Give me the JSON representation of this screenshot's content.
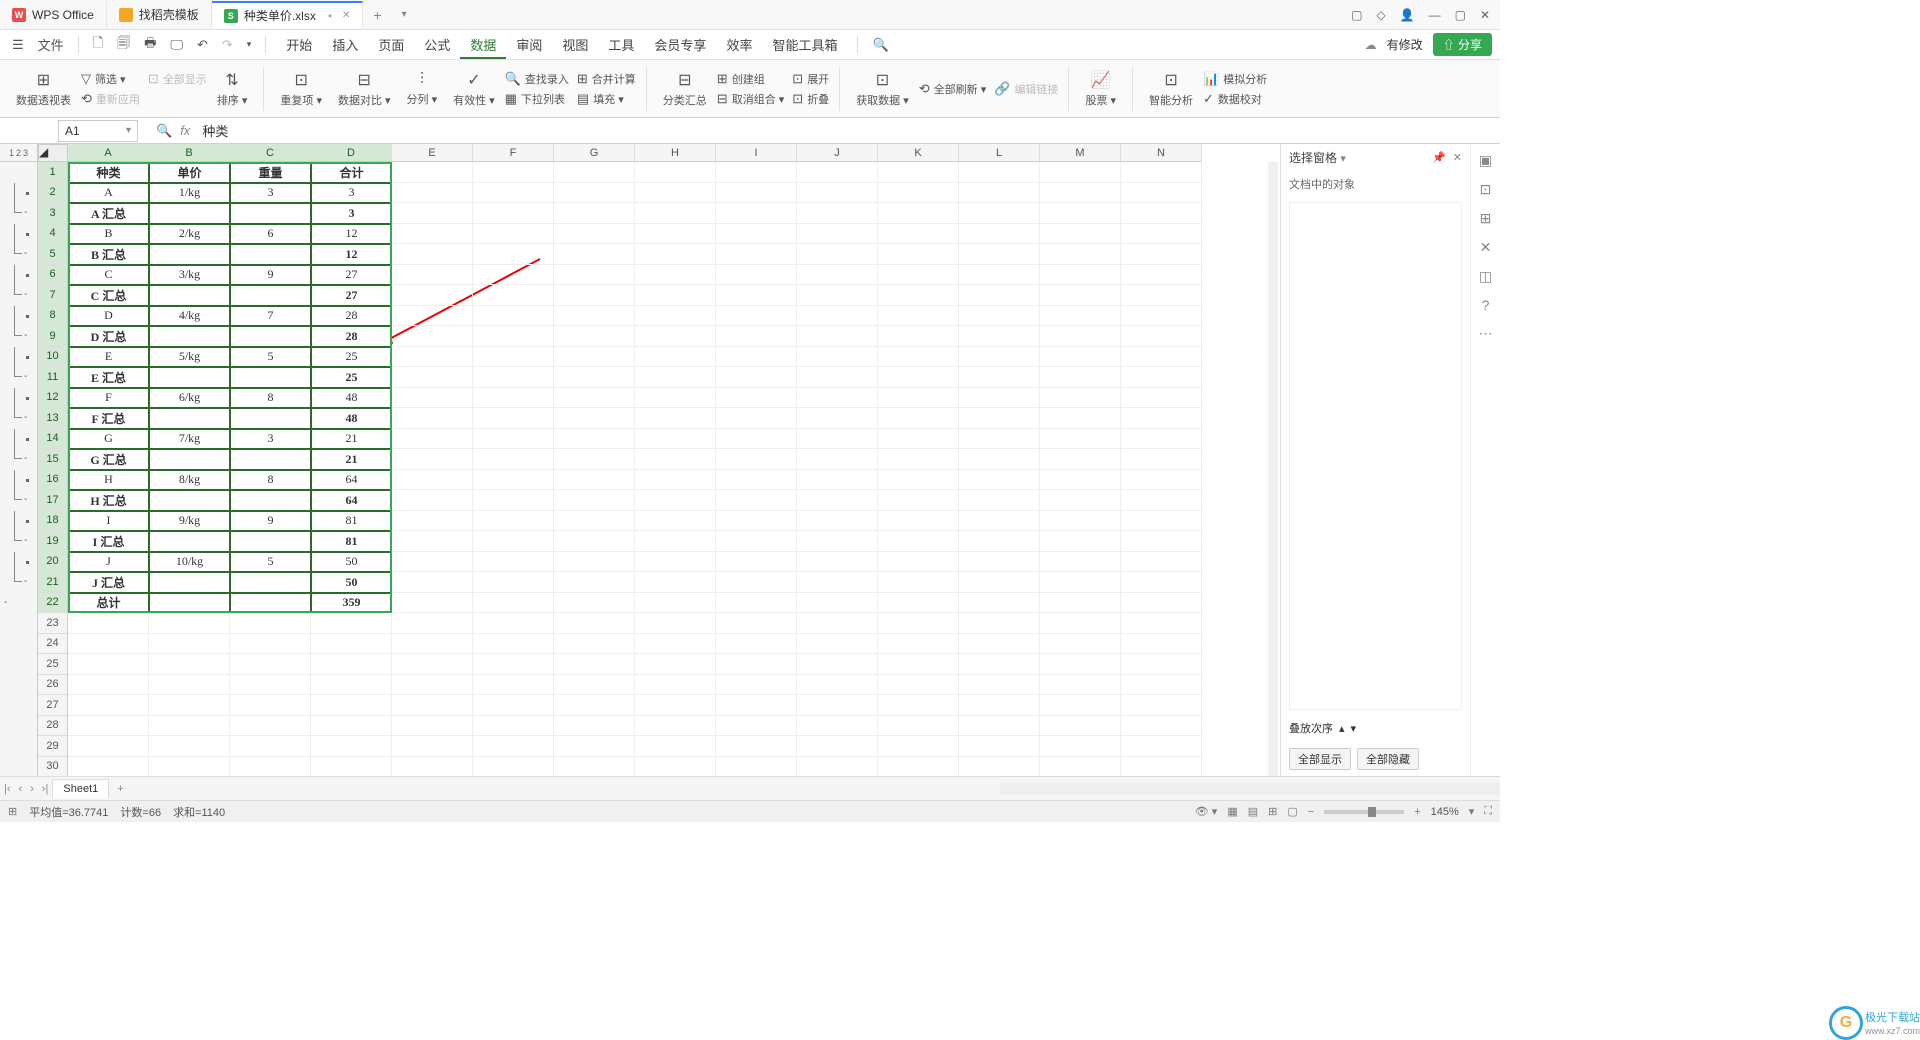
{
  "titlebar": {
    "tabs": [
      {
        "icon": "wps",
        "label": "WPS Office"
      },
      {
        "icon": "t",
        "label": "找稻壳模板"
      },
      {
        "icon": "s",
        "label": "种类单价.xlsx",
        "active": true,
        "dirty": true
      }
    ],
    "win_icons": [
      "▢",
      "◇",
      "👤",
      "—",
      "▢",
      "✕"
    ]
  },
  "menu": {
    "file": "文件",
    "quick_icons": [
      "🗋",
      "🗐",
      "🖶",
      "🖫",
      "↶",
      "↷",
      "▾"
    ],
    "tabs": [
      "开始",
      "插入",
      "页面",
      "公式",
      "数据",
      "审阅",
      "视图",
      "工具",
      "会员专享",
      "效率",
      "智能工具箱"
    ],
    "active_tab": "数据",
    "search_icon": "🔍",
    "right": {
      "cloud": "⟳",
      "modify": "有修改",
      "share": "分享"
    }
  },
  "ribbon": {
    "groups": [
      {
        "type": "big",
        "icon": "⊞",
        "label": "数据透视表"
      },
      {
        "type": "stack",
        "items": [
          {
            "icon": "▽",
            "label": "筛选",
            "dd": true
          },
          {
            "icon": "⟲",
            "label": "重新应用",
            "disabled": true
          }
        ],
        "side": [
          {
            "icon": "⊡",
            "label": "全部显示",
            "disabled": true
          }
        ]
      },
      {
        "type": "big",
        "icon": "⇅",
        "label": "排序",
        "dd": true
      },
      {
        "type": "sep"
      },
      {
        "type": "big",
        "icon": "⊡",
        "label": "重复项",
        "dd": true
      },
      {
        "type": "big",
        "icon": "⊟",
        "label": "数据对比",
        "dd": true
      },
      {
        "type": "big",
        "icon": "⫶",
        "label": "分列",
        "dd": true
      },
      {
        "type": "big",
        "icon": "✓",
        "label": "有效性",
        "dd": true
      },
      {
        "type": "stack2",
        "items": [
          {
            "icon": "🔍",
            "label": "查找录入"
          },
          {
            "icon": "▦",
            "label": "下拉列表"
          }
        ],
        "side": [
          {
            "icon": "⊞",
            "label": "合并计算"
          },
          {
            "icon": "▤",
            "label": "填充",
            "dd": true
          }
        ]
      },
      {
        "type": "sep"
      },
      {
        "type": "big",
        "icon": "⊟",
        "label": "分类汇总"
      },
      {
        "type": "stack2",
        "items": [
          {
            "icon": "⊞",
            "label": "创建组"
          },
          {
            "icon": "⊟",
            "label": "取消组合",
            "dd": true
          }
        ],
        "side": [
          {
            "icon": "⊡",
            "label": "展开"
          },
          {
            "icon": "⊡",
            "label": "折叠"
          }
        ]
      },
      {
        "type": "sep"
      },
      {
        "type": "big",
        "icon": "⊡",
        "label": "获取数据",
        "dd": true
      },
      {
        "type": "stack2",
        "items": [
          {
            "icon": "⟲",
            "label": "全部刷新",
            "dd": true
          }
        ],
        "side": [
          {
            "icon": "🔗",
            "label": "编辑链接",
            "disabled": true
          }
        ]
      },
      {
        "type": "sep"
      },
      {
        "type": "big",
        "icon": "📈",
        "label": "股票",
        "dd": true
      },
      {
        "type": "sep"
      },
      {
        "type": "big",
        "icon": "⊡",
        "label": "智能分析"
      },
      {
        "type": "stack2",
        "items": [
          {
            "icon": "📊",
            "label": "模拟分析"
          },
          {
            "icon": "✓",
            "label": "数据校对"
          }
        ]
      }
    ]
  },
  "formulabar": {
    "namebox": "A1",
    "fx": "fx",
    "value": "种类"
  },
  "outline_levels": [
    "1",
    "2",
    "3"
  ],
  "columns": [
    "A",
    "B",
    "C",
    "D",
    "E",
    "F",
    "G",
    "H",
    "I",
    "J",
    "K",
    "L",
    "M",
    "N"
  ],
  "sel_cols": [
    "A",
    "B",
    "C",
    "D"
  ],
  "rows": [
    {
      "n": 1,
      "sel": true,
      "type": "hdr",
      "cells": [
        "种类",
        "单价",
        "重量",
        "合计"
      ]
    },
    {
      "n": 2,
      "sel": true,
      "cells": [
        "A",
        "1/kg",
        "3",
        "3"
      ],
      "outline": "dot"
    },
    {
      "n": 3,
      "sel": true,
      "cells": [
        "A 汇总",
        "",
        "",
        "3"
      ],
      "bold": true,
      "outline": "end"
    },
    {
      "n": 4,
      "sel": true,
      "cells": [
        "B",
        "2/kg",
        "6",
        "12"
      ],
      "outline": "dot"
    },
    {
      "n": 5,
      "sel": true,
      "cells": [
        "B 汇总",
        "",
        "",
        "12"
      ],
      "bold": true,
      "outline": "end"
    },
    {
      "n": 6,
      "sel": true,
      "cells": [
        "C",
        "3/kg",
        "9",
        "27"
      ],
      "outline": "dot"
    },
    {
      "n": 7,
      "sel": true,
      "cells": [
        "C 汇总",
        "",
        "",
        "27"
      ],
      "bold": true,
      "outline": "end"
    },
    {
      "n": 8,
      "sel": true,
      "cells": [
        "D",
        "4/kg",
        "7",
        "28"
      ],
      "outline": "dot"
    },
    {
      "n": 9,
      "sel": true,
      "cells": [
        "D 汇总",
        "",
        "",
        "28"
      ],
      "bold": true,
      "outline": "end"
    },
    {
      "n": 10,
      "sel": true,
      "cells": [
        "E",
        "5/kg",
        "5",
        "25"
      ],
      "outline": "dot"
    },
    {
      "n": 11,
      "sel": true,
      "cells": [
        "E 汇总",
        "",
        "",
        "25"
      ],
      "bold": true,
      "outline": "end"
    },
    {
      "n": 12,
      "sel": true,
      "cells": [
        "F",
        "6/kg",
        "8",
        "48"
      ],
      "outline": "dot"
    },
    {
      "n": 13,
      "sel": true,
      "cells": [
        "F 汇总",
        "",
        "",
        "48"
      ],
      "bold": true,
      "outline": "end"
    },
    {
      "n": 14,
      "sel": true,
      "cells": [
        "G",
        "7/kg",
        "3",
        "21"
      ],
      "outline": "dot"
    },
    {
      "n": 15,
      "sel": true,
      "cells": [
        "G 汇总",
        "",
        "",
        "21"
      ],
      "bold": true,
      "outline": "end"
    },
    {
      "n": 16,
      "sel": true,
      "cells": [
        "H",
        "8/kg",
        "8",
        "64"
      ],
      "outline": "dot"
    },
    {
      "n": 17,
      "sel": true,
      "cells": [
        "H 汇总",
        "",
        "",
        "64"
      ],
      "bold": true,
      "outline": "end"
    },
    {
      "n": 18,
      "sel": true,
      "cells": [
        "I",
        "9/kg",
        "9",
        "81"
      ],
      "outline": "dot"
    },
    {
      "n": 19,
      "sel": true,
      "cells": [
        "I 汇总",
        "",
        "",
        "81"
      ],
      "bold": true,
      "outline": "end"
    },
    {
      "n": 20,
      "sel": true,
      "cells": [
        "J",
        "10/kg",
        "5",
        "50"
      ],
      "outline": "dot"
    },
    {
      "n": 21,
      "sel": true,
      "cells": [
        "J 汇总",
        "",
        "",
        "50"
      ],
      "bold": true,
      "outline": "end"
    },
    {
      "n": 22,
      "sel": true,
      "cells": [
        "总计",
        "",
        "",
        "359"
      ],
      "bold": true,
      "outline": "total"
    },
    {
      "n": 23
    },
    {
      "n": 24
    },
    {
      "n": 25
    },
    {
      "n": 26
    },
    {
      "n": 27
    },
    {
      "n": 28
    },
    {
      "n": 29
    },
    {
      "n": 30
    }
  ],
  "rightpanel": {
    "title": "选择窗格",
    "sub": "文档中的对象",
    "stack_label": "叠放次序",
    "btn_showall": "全部显示",
    "btn_hideall": "全部隐藏"
  },
  "sidetools": [
    "▣",
    "⊡",
    "⊞",
    "✕",
    "◫",
    "?",
    "⋯"
  ],
  "sheettabs": {
    "active": "Sheet1"
  },
  "statusbar": {
    "left_icon": "⊞",
    "avg": "平均值=36.7741",
    "count": "计数=66",
    "sum": "求和=1140",
    "zoom": "145%",
    "views": [
      "⊞",
      "▤",
      "▦",
      "▢"
    ]
  },
  "watermark": {
    "brand": "极光下载站",
    "url": "www.xz7.com"
  }
}
